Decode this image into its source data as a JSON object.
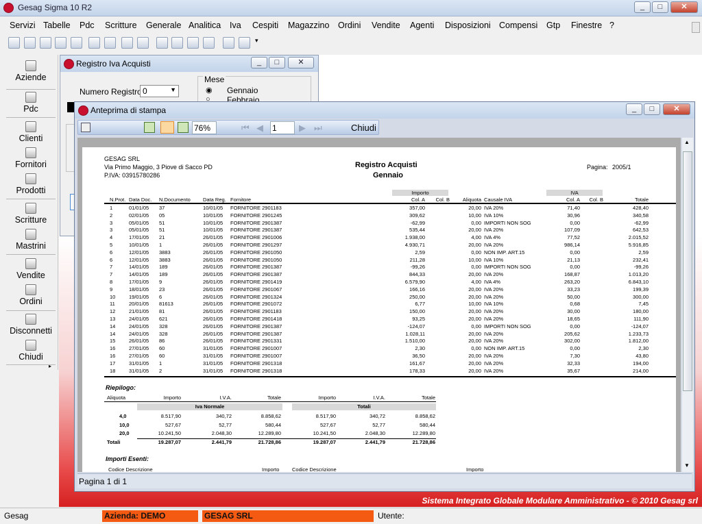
{
  "app": {
    "title": "Gesag Sigma 10 R2"
  },
  "menu": [
    "Servizi",
    "Tabelle",
    "Pdc",
    "Scritture",
    "Generale",
    "Analitica",
    "Iva",
    "Cespiti",
    "Magazzino",
    "Ordini",
    "Vendite",
    "Agenti",
    "Disposizioni",
    "Compensi",
    "Gtp",
    "Finestre",
    "?"
  ],
  "sidebar": [
    "Aziende",
    "Pdc",
    "Clienti",
    "Fornitori",
    "Prodotti",
    "Scritture",
    "Mastrini",
    "Vendite",
    "Ordini",
    "Disconnetti",
    "Chiudi"
  ],
  "registro": {
    "title": "Registro Iva Acquisti",
    "numero_label": "Numero Registro:",
    "numero_value": "0",
    "mese_label": "Mese",
    "mesi": [
      "Gennaio",
      "Febbraio"
    ]
  },
  "preview": {
    "title": "Anteprima di stampa",
    "zoom": "76%",
    "page": "1",
    "close_label": "Chiudi",
    "page_status": "Pagina 1 di 1"
  },
  "report": {
    "company": "GESAG SRL",
    "address": "Via Primo Maggio, 3 Piove di Sacco PD",
    "piva": "P.IVA: 03915780286",
    "title": "Registro Acquisti",
    "subtitle": "Gennaio",
    "page_label": "Pagina:",
    "page_value": "2005/1",
    "group_importo": "Importo",
    "group_iva": "IVA",
    "headers": [
      "N.Prot.",
      "Data Doc.",
      "N.Documento",
      "Data Reg.",
      "Fornitore",
      "Col. A",
      "Col. B",
      "Aliquota",
      "Causale IVA",
      "Col. A",
      "Col. B",
      "Totale"
    ],
    "rows": [
      [
        "1",
        "01/01/05",
        "37",
        "10/01/05",
        "FORNITORE 2901183",
        "357,00",
        "",
        "20,00",
        "IVA 20%",
        "71,40",
        "",
        "428,40"
      ],
      [
        "2",
        "02/01/05",
        "05",
        "10/01/05",
        "FORNITORE 2901245",
        "309,62",
        "",
        "10,00",
        "IVA 10%",
        "30,96",
        "",
        "340,58"
      ],
      [
        "3",
        "05/01/05",
        "51",
        "10/01/05",
        "FORNITORE 2901387",
        "-62,99",
        "",
        "0,00",
        "IMPORTI NON SOG",
        "0,00",
        "",
        "-62,99"
      ],
      [
        "3",
        "05/01/05",
        "51",
        "10/01/05",
        "FORNITORE 2901387",
        "535,44",
        "",
        "20,00",
        "IVA 20%",
        "107,09",
        "",
        "642,53"
      ],
      [
        "4",
        "17/01/05",
        "21",
        "26/01/05",
        "FORNITORE 2901006",
        "1.938,00",
        "",
        "4,00",
        "IVA 4%",
        "77,52",
        "",
        "2.015,52"
      ],
      [
        "5",
        "10/01/05",
        "1",
        "26/01/05",
        "FORNITORE 2901297",
        "4.930,71",
        "",
        "20,00",
        "IVA 20%",
        "986,14",
        "",
        "5.916,85"
      ],
      [
        "6",
        "12/01/05",
        "3883",
        "26/01/05",
        "FORNITORE 2901050",
        "2,59",
        "",
        "0,00",
        "NON IMP. ART.15",
        "0,00",
        "",
        "2,59"
      ],
      [
        "6",
        "12/01/05",
        "3883",
        "26/01/05",
        "FORNITORE 2901050",
        "211,28",
        "",
        "10,00",
        "IVA 10%",
        "21,13",
        "",
        "232,41"
      ],
      [
        "7",
        "14/01/05",
        "189",
        "26/01/05",
        "FORNITORE 2901387",
        "-99,26",
        "",
        "0,00",
        "IMPORTI NON SOG",
        "0,00",
        "",
        "-99,26"
      ],
      [
        "7",
        "14/01/05",
        "189",
        "26/01/05",
        "FORNITORE 2901387",
        "844,33",
        "",
        "20,00",
        "IVA 20%",
        "168,87",
        "",
        "1.013,20"
      ],
      [
        "8",
        "17/01/05",
        "9",
        "26/01/05",
        "FORNITORE 2901419",
        "6.579,90",
        "",
        "4,00",
        "IVA 4%",
        "263,20",
        "",
        "6.843,10"
      ],
      [
        "9",
        "18/01/05",
        "23",
        "26/01/05",
        "FORNITORE 2901067",
        "166,16",
        "",
        "20,00",
        "IVA 20%",
        "33,23",
        "",
        "199,39"
      ],
      [
        "10",
        "19/01/05",
        "6",
        "26/01/05",
        "FORNITORE 2901324",
        "250,00",
        "",
        "20,00",
        "IVA 20%",
        "50,00",
        "",
        "300,00"
      ],
      [
        "11",
        "20/01/05",
        "81613",
        "26/01/05",
        "FORNITORE 2901072",
        "6,77",
        "",
        "10,00",
        "IVA 10%",
        "0,68",
        "",
        "7,45"
      ],
      [
        "12",
        "21/01/05",
        "81",
        "26/01/05",
        "FORNITORE 2901183",
        "150,00",
        "",
        "20,00",
        "IVA 20%",
        "30,00",
        "",
        "180,00"
      ],
      [
        "13",
        "24/01/05",
        "621",
        "26/01/05",
        "FORNITORE 2901418",
        "93,25",
        "",
        "20,00",
        "IVA 20%",
        "18,65",
        "",
        "111,90"
      ],
      [
        "14",
        "24/01/05",
        "328",
        "26/01/05",
        "FORNITORE 2901387",
        "-124,07",
        "",
        "0,00",
        "IMPORTI NON SOG",
        "0,00",
        "",
        "-124,07"
      ],
      [
        "14",
        "24/01/05",
        "328",
        "26/01/05",
        "FORNITORE 2901387",
        "1.028,11",
        "",
        "20,00",
        "IVA 20%",
        "205,62",
        "",
        "1.233,73"
      ],
      [
        "15",
        "26/01/05",
        "86",
        "26/01/05",
        "FORNITORE 2901331",
        "1.510,00",
        "",
        "20,00",
        "IVA 20%",
        "302,00",
        "",
        "1.812,00"
      ],
      [
        "16",
        "27/01/05",
        "60",
        "31/01/05",
        "FORNITORE 2901007",
        "2,30",
        "",
        "0,00",
        "NON IMP. ART.15",
        "0,00",
        "",
        "2,30"
      ],
      [
        "16",
        "27/01/05",
        "60",
        "31/01/05",
        "FORNITORE 2901007",
        "36,50",
        "",
        "20,00",
        "IVA 20%",
        "7,30",
        "",
        "43,80"
      ],
      [
        "17",
        "31/01/05",
        "1",
        "31/01/05",
        "FORNITORE 2901318",
        "161,67",
        "",
        "20,00",
        "IVA 20%",
        "32,33",
        "",
        "194,00"
      ],
      [
        "18",
        "31/01/05",
        "2",
        "31/01/05",
        "FORNITORE 2901318",
        "178,33",
        "",
        "20,00",
        "IVA 20%",
        "35,67",
        "",
        "214,00"
      ]
    ],
    "riepilogo_title": "Riepilogo:",
    "riep_headers": [
      "Aliquota",
      "Importo",
      "I.V.A.",
      "Totale",
      "Importo",
      "I.V.A.",
      "Totale"
    ],
    "riep_group1": "Iva Normale",
    "riep_group2": "Totali",
    "riep_rows": [
      [
        "4,0",
        "8.517,90",
        "340,72",
        "8.858,62",
        "8.517,90",
        "340,72",
        "8.858,62"
      ],
      [
        "10,0",
        "527,67",
        "52,77",
        "580,44",
        "527,67",
        "52,77",
        "580,44"
      ],
      [
        "20,0",
        "10.241,50",
        "2.048,30",
        "12.289,80",
        "10.241,50",
        "2.048,30",
        "12.289,80"
      ],
      [
        "Totali",
        "19.287,07",
        "2.441,79",
        "21.728,86",
        "19.287,07",
        "2.441,79",
        "21.728,86"
      ]
    ],
    "esenti_title": "Importi Esenti:",
    "esenti_headers": [
      "Codice Descrizione",
      "Importo",
      "Codice Descrizione",
      "Importo"
    ]
  },
  "status": {
    "left": "Gesag",
    "azienda": "Azienda: DEMO",
    "company": "GESAG SRL",
    "utente": "Utente:"
  },
  "footer": "Sistema Integrato Globale Modulare Amministrativo - © 2010 Gesag srl",
  "colors": {
    "accent": "#c8102e",
    "status_orange": "#f45a12",
    "mdi_red": "#d62020"
  },
  "icons": [
    "home-icon",
    "printer-icon",
    "zoom-icon",
    "first-page-icon",
    "prev-page-icon",
    "next-page-icon",
    "last-page-icon"
  ]
}
